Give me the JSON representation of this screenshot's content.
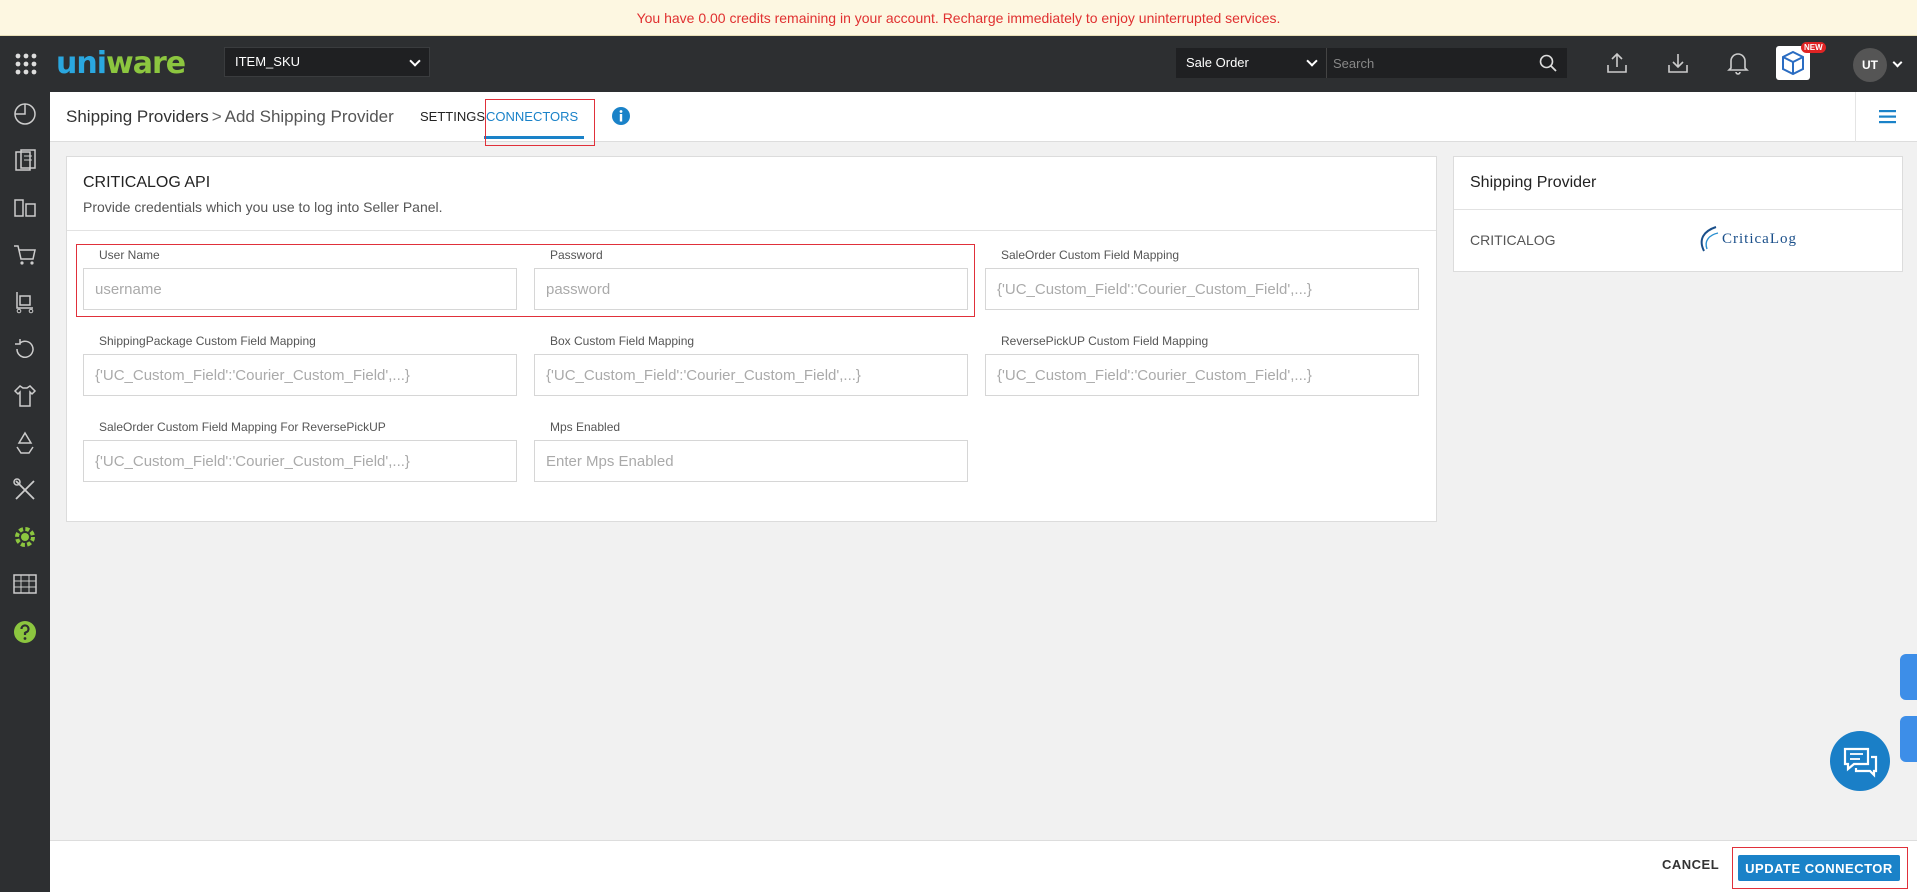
{
  "banner": {
    "message": "You have 0.00 credits remaining in your account. Recharge immediately to enjoy uninterrupted services."
  },
  "topbar": {
    "brand_first": "uni",
    "brand_second": "ware",
    "sku_select_value": "ITEM_SKU",
    "search_type_value": "Sale Order",
    "search_placeholder": "Search",
    "new_badge": "NEW",
    "avatar_initials": "UT"
  },
  "sidebar": {
    "items": [
      "dashboard-icon",
      "orders-icon",
      "products-icon",
      "cart-icon",
      "trolley-icon",
      "returns-icon",
      "apparel-icon",
      "recycle-icon",
      "tools-icon",
      "settings-icon",
      "barcode-icon",
      "help-icon"
    ],
    "active_color": "#8cc63f"
  },
  "subheader": {
    "breadcrumb_parent": "Shipping Providers",
    "breadcrumb_separator": ">",
    "breadcrumb_current": "Add Shipping Provider",
    "tabs": [
      {
        "label": "SETTINGS",
        "active": false
      },
      {
        "label": "CONNECTORS",
        "active": true
      }
    ]
  },
  "connector_card": {
    "title": "CRITICALOG API",
    "subtitle": "Provide credentials which you use to log into Seller Panel.",
    "fields": [
      {
        "label": "User Name",
        "placeholder": "username"
      },
      {
        "label": "Password",
        "placeholder": "password"
      },
      {
        "label": "SaleOrder Custom Field Mapping",
        "placeholder": "{'UC_Custom_Field':'Courier_Custom_Field',...}"
      },
      {
        "label": "ShippingPackage Custom Field Mapping",
        "placeholder": "{'UC_Custom_Field':'Courier_Custom_Field',...}"
      },
      {
        "label": "Box Custom Field Mapping",
        "placeholder": "{'UC_Custom_Field':'Courier_Custom_Field',...}"
      },
      {
        "label": "ReversePickUP Custom Field Mapping",
        "placeholder": "{'UC_Custom_Field':'Courier_Custom_Field',...}"
      },
      {
        "label": "SaleOrder Custom Field Mapping For ReversePickUP",
        "placeholder": "{'UC_Custom_Field':'Courier_Custom_Field',...}"
      },
      {
        "label": "Mps Enabled",
        "placeholder": "Enter Mps Enabled"
      }
    ]
  },
  "provider_card": {
    "title": "Shipping Provider",
    "name": "CRITICALOG",
    "logo_text": "CriticaLog"
  },
  "footer": {
    "cancel_label": "CANCEL",
    "update_label": "UPDATE CONNECTOR"
  },
  "colors": {
    "accent": "#1a82c8",
    "highlight": "#e0303a",
    "banner_text": "#e03030",
    "topbar_bg": "#2d2f31"
  }
}
